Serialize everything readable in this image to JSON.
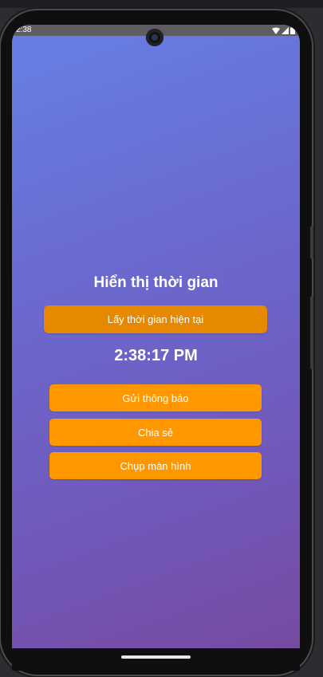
{
  "status_bar": {
    "time": "2:38"
  },
  "app": {
    "title": "Hiển thị thời gian",
    "get_time_button": "Lấy thời gian hiện tại",
    "time_value": "2:38:17 PM",
    "buttons": {
      "send_notification": "Gửi thông báo",
      "share": "Chia sẻ",
      "screenshot": "Chụp màn hình"
    }
  },
  "colors": {
    "gradient_start": "#6680e6",
    "gradient_end": "#764ba2",
    "primary_button": "#e68900",
    "action_button": "#ff9800",
    "text": "#ffffff"
  },
  "icons": {
    "status": [
      "wifi-icon",
      "signal-icon",
      "battery-icon"
    ]
  }
}
